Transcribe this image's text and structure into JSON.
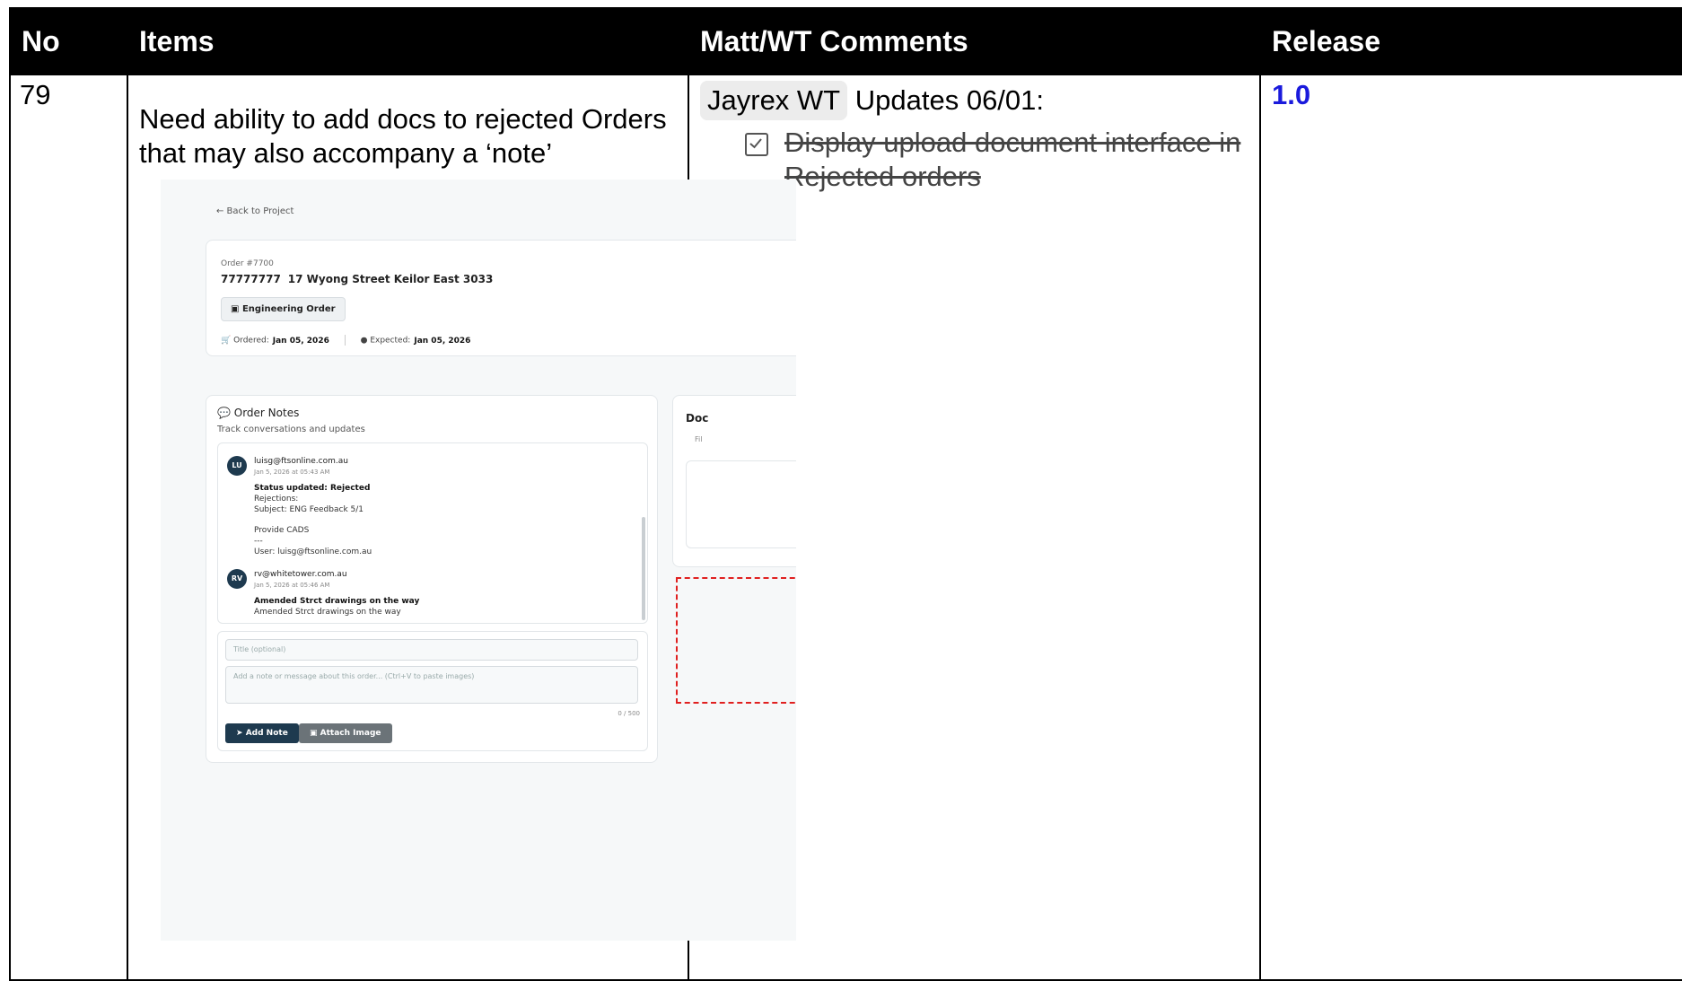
{
  "header": {
    "no": "No",
    "items": "Items",
    "comments": "Matt/WT Comments",
    "release": "Release"
  },
  "row": {
    "no": "79",
    "item_text": "Need ability to add docs to rejected Orders that may also accompany a ‘note’",
    "release": "1.0",
    "comment": {
      "mention": "Jayrex WT",
      "update": "Updates 06/01:",
      "checklist": [
        {
          "text": "Display upload document interface in Rejected orders",
          "checked": true
        }
      ]
    }
  },
  "screenshot": {
    "back_link": "← Back to Project",
    "order_number": "Order #7700",
    "order_id": "77777777",
    "address": "17 Wyong Street Keilor East 3033",
    "badge": "Engineering Order",
    "ordered_label": "Ordered:",
    "ordered_date": "Jan 05, 2026",
    "expected_label": "Expected:",
    "expected_date": "Jan 05, 2026",
    "notes_title": "Order Notes",
    "notes_subtitle": "Track conversations and updates",
    "notes": [
      {
        "initials": "LU",
        "email": "luisg@ftsonline.com.au",
        "time": "Jan 5, 2026 at 05:43 AM",
        "title": "Status updated: Rejected",
        "lines": [
          "Rejections:",
          "Subject: ENG Feedback 5/1",
          "",
          "Provide CADS",
          "---",
          "User: luisg@ftsonline.com.au"
        ]
      },
      {
        "initials": "RV",
        "email": "rv@whitetower.com.au",
        "time": "Jan 5, 2026 at 05:46 AM",
        "title": "Amended Strct drawings on the way",
        "lines": [
          "Amended Strct drawings on the way"
        ]
      }
    ],
    "title_placeholder": "Title (optional)",
    "message_placeholder": "Add a note or message about this order... (Ctrl+V to paste images)",
    "counter": "0 / 500",
    "add_note": "Add Note",
    "attach_image": "Attach Image",
    "docs_title": "Doc",
    "docs_sub": "Fil"
  },
  "colors": {
    "header_bg": "#000000",
    "release_link": "#1a1adc",
    "highlight_border": "#e02020",
    "primary_button": "#1e3a4f"
  }
}
